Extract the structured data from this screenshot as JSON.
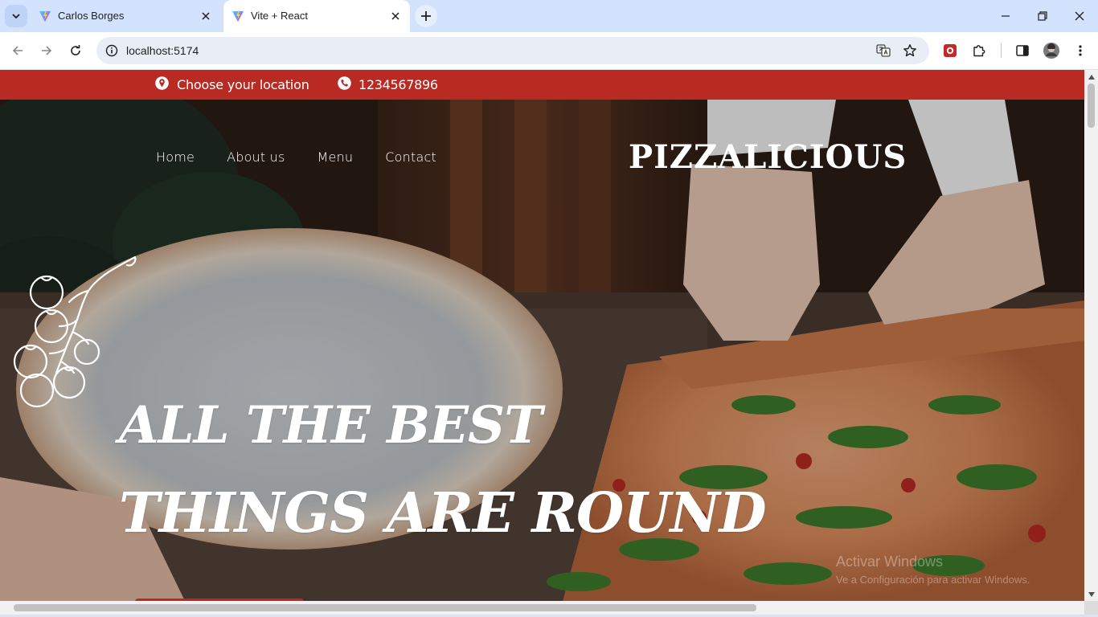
{
  "browser": {
    "tabs": [
      {
        "title": "Carlos Borges",
        "favicon": "vite-logo-icon",
        "active": false
      },
      {
        "title": "Vite + React",
        "favicon": "vite-logo-icon",
        "active": true
      }
    ],
    "url": "localhost:5174",
    "colors": {
      "tabstrip": "#d3e3fd",
      "omnibox": "#e9eef6"
    }
  },
  "page": {
    "topbar": {
      "location_label": "Choose your location",
      "phone": "1234567896",
      "color": "#b82a22"
    },
    "nav": {
      "items": [
        {
          "label": "Home"
        },
        {
          "label": "About us"
        },
        {
          "label": "Menu"
        },
        {
          "label": "Contact"
        }
      ]
    },
    "brand": "PIZZALICIOUS",
    "hero": {
      "headline_line1": "ALL THE BEST",
      "headline_line2": "THINGS ARE ROUND",
      "decor_icon": "tomato-vine-icon"
    },
    "watermark": {
      "line1": "Activar Windows",
      "line2": "Ve a Configuración para activar Windows."
    }
  }
}
